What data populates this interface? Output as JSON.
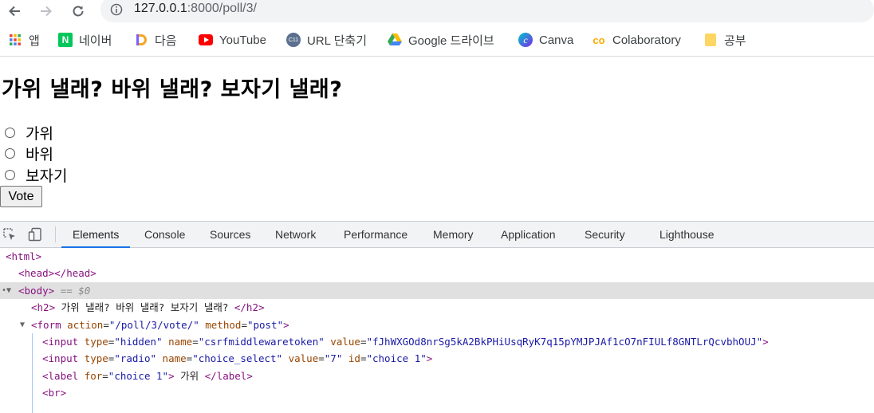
{
  "browser": {
    "url_host": "127.0.0.1",
    "url_rest": ":8000/poll/3/"
  },
  "bookmarks": [
    {
      "label": "앱",
      "icon": "apps-grid-icon"
    },
    {
      "label": "네이버",
      "icon": "naver-icon"
    },
    {
      "label": "다음",
      "icon": "daum-icon"
    },
    {
      "label": "YouTube",
      "icon": "youtube-icon"
    },
    {
      "label": "URL 단축기",
      "icon": "url-shortener-icon"
    },
    {
      "label": "Google 드라이브",
      "icon": "google-drive-icon"
    },
    {
      "label": "Canva",
      "icon": "canva-icon"
    },
    {
      "label": "Colaboratory",
      "icon": "colab-icon"
    },
    {
      "label": "공부",
      "icon": "folder-icon"
    }
  ],
  "poll": {
    "question": "가위 낼래? 바위 낼래? 보자기 낼래?",
    "choices": [
      "가위",
      "바위",
      "보자기"
    ],
    "vote_label": "Vote"
  },
  "devtools": {
    "tabs": [
      "Elements",
      "Console",
      "Sources",
      "Network",
      "Performance",
      "Memory",
      "Application",
      "Security",
      "Lighthouse"
    ],
    "active_tab": "Elements",
    "dom": {
      "html_open": "<html>",
      "head": "<head></head>",
      "body_open": "<body>",
      "body_marker": "== $0",
      "h2_text": " 가위 낼래? 바위 낼래? 보자기 낼래? ",
      "form_action": "\"/poll/3/vote/\"",
      "form_method": "\"post\"",
      "input1_type": "\"hidden\"",
      "input1_name": "\"csrfmiddlewaretoken\"",
      "input1_value": "\"fJhWXGOd8nrSg5kA2BkPHiUsqRyK7q15pYMJPJAf1cO7nFIULf8GNTLrQcvbhOUJ\"",
      "input2_type": "\"radio\"",
      "input2_name": "\"choice_select\"",
      "input2_value": "\"7\"",
      "input2_id": "\"choice 1\"",
      "label_for": "\"choice 1\"",
      "label_text": " 가위 ",
      "br": "<br>"
    }
  }
}
